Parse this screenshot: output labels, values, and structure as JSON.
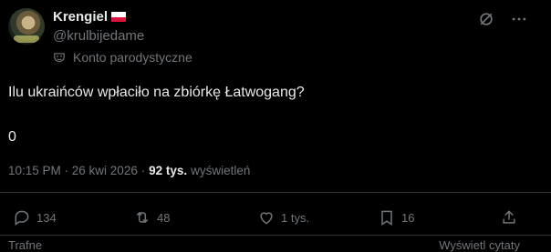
{
  "author": {
    "name": "Krengiel",
    "handle": "@krulbijedame",
    "label": "Konto parodystyczne"
  },
  "tweet": {
    "text": "Ilu ukraińców wpłaciło na zbiórkę Łatwogang?",
    "text2": "0",
    "time": "10:15 PM · 26 kwi 2026 ·",
    "views_count": "92 tys.",
    "views_label": "wyświetleń"
  },
  "actions": {
    "replies": "134",
    "reposts": "48",
    "likes": "1 tys.",
    "bookmarks": "16"
  },
  "footer": {
    "left": "Trafne",
    "right": "Wyświetl cytaty"
  },
  "icons": {
    "grok": "grok-icon",
    "more": "more-icon",
    "reply": "reply-icon",
    "repost": "repost-icon",
    "like": "heart-icon",
    "bookmark": "bookmark-icon",
    "share": "share-icon",
    "parody": "mask-icon"
  },
  "colors": {
    "background": "#000000",
    "text": "#e7e9ea",
    "muted": "#71767b",
    "divider": "#2f3336"
  }
}
